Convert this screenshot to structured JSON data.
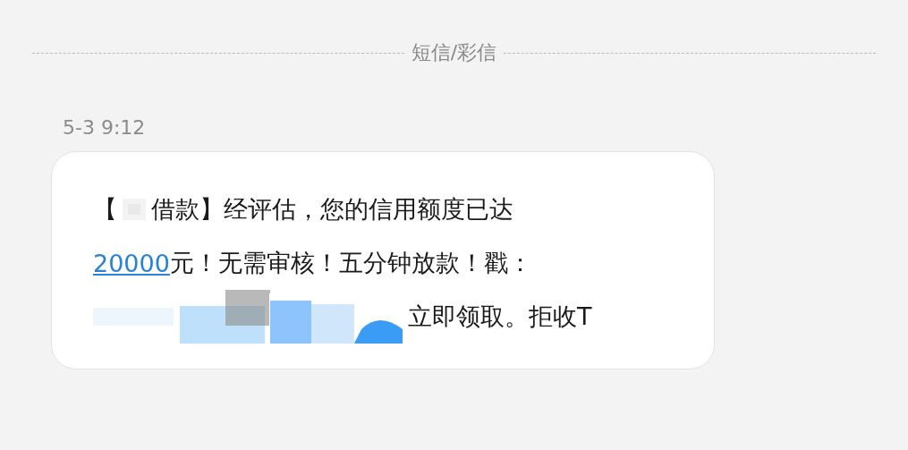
{
  "header": {
    "title": "短信/彩信"
  },
  "message": {
    "time": "5-3 9:12",
    "lines": [
      [
        {
          "kind": "text",
          "text": "【"
        },
        {
          "kind": "redacted"
        },
        {
          "kind": "text",
          "text": "借款】经评估，您的信用额度已达"
        }
      ],
      [
        {
          "kind": "link",
          "text": "20000"
        },
        {
          "kind": "text",
          "text": "元！无需审核！五分钟放款！戳："
        }
      ],
      [
        {
          "kind": "redacted_link"
        },
        {
          "kind": "text",
          "text": "立即领取。拒收T"
        }
      ]
    ]
  }
}
